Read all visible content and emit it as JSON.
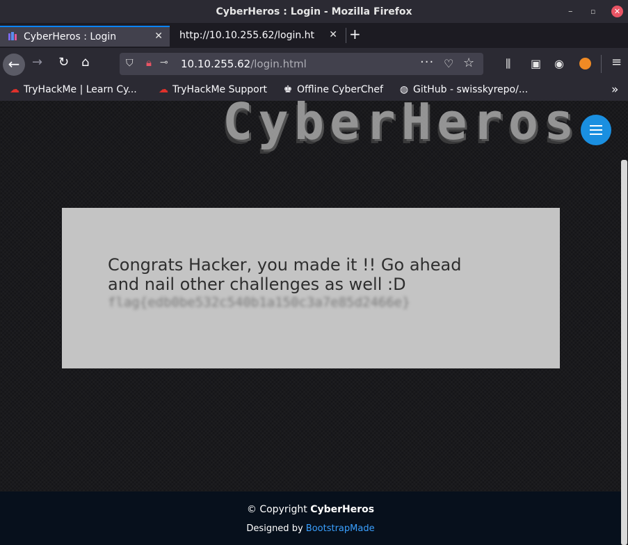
{
  "window": {
    "title": "CyberHeros : Login - Mozilla Firefox"
  },
  "tabs": [
    {
      "label": "CyberHeros : Login",
      "active": true
    },
    {
      "label": "http://10.10.255.62/login.ht",
      "active": false
    }
  ],
  "navigation": {
    "url_host": "10.10.255.62",
    "url_path": "/login.html"
  },
  "bookmarks": [
    {
      "label": "TryHackMe | Learn Cy...",
      "icon": "tryhackme-icon"
    },
    {
      "label": "TryHackMe Support",
      "icon": "tryhackme-icon"
    },
    {
      "label": "Offline CyberChef",
      "icon": "chef-hat-icon"
    },
    {
      "label": "GitHub - swisskyrepo/...",
      "icon": "github-icon"
    }
  ],
  "page": {
    "banner_text": "CyberHeros",
    "message": "Congrats Hacker, you made it !! Go ahead and nail other challenges as well :D",
    "flag": "flag{edb0be532c540b1a150c3a7e85d2466e}",
    "footer": {
      "copyright_prefix": "© Copyright",
      "copyright_brand": "CyberHeros",
      "designed_by": "Designed by",
      "designer": "BootstrapMade"
    }
  },
  "colors": {
    "accent": "#1a8fe0",
    "link": "#3aa0ff",
    "box": "#c4c4c4"
  }
}
